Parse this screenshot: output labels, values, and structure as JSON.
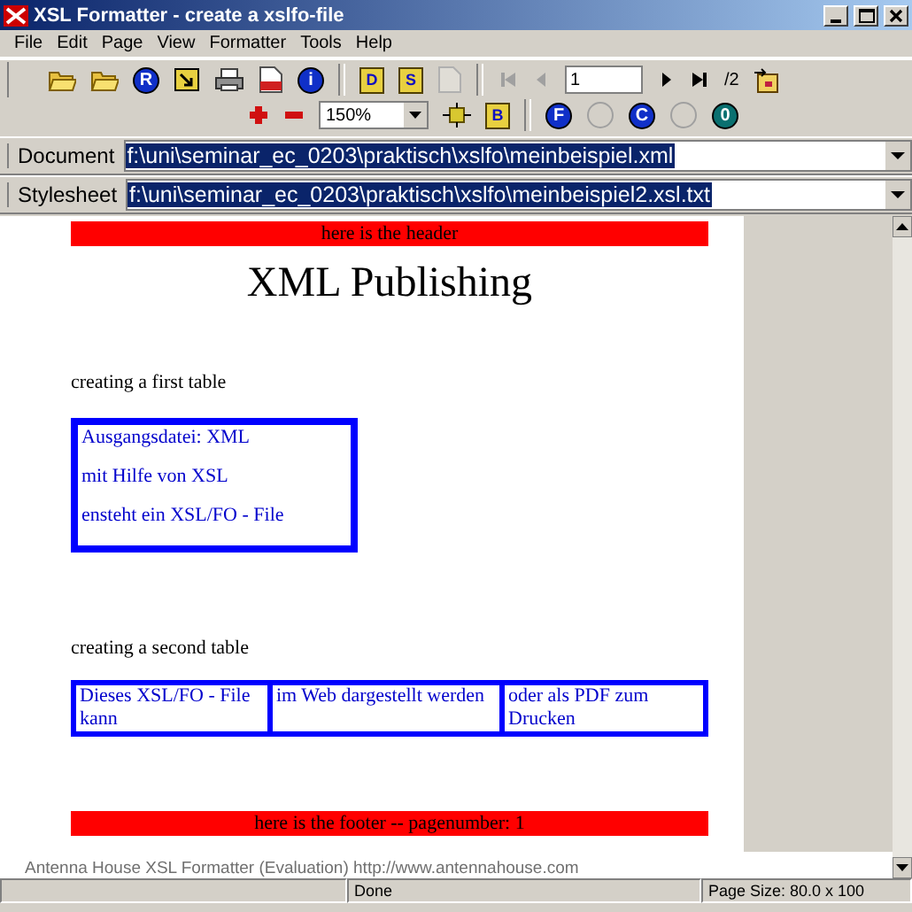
{
  "window": {
    "title": "XSL Formatter - create a xslfo-file"
  },
  "menu": [
    "File",
    "Edit",
    "Page",
    "View",
    "Formatter",
    "Tools",
    "Help"
  ],
  "toolbar": {
    "row_1": [
      {
        "kind": "folder"
      },
      {
        "kind": "folder"
      },
      {
        "kind": "badge",
        "label": "R",
        "color": "#1030c8"
      },
      {
        "kind": "doc-arrow"
      },
      {
        "kind": "printer"
      },
      {
        "kind": "pdf"
      },
      {
        "kind": "badge",
        "label": "i",
        "color": "#1030c8"
      },
      {
        "kind": "separator"
      },
      {
        "kind": "page",
        "label": "D",
        "disabled": false
      },
      {
        "kind": "page",
        "label": "S",
        "disabled": false
      },
      {
        "kind": "page",
        "disabled": true
      },
      {
        "kind": "separator"
      },
      {
        "kind": "first",
        "disabled": true
      },
      {
        "kind": "prev",
        "disabled": true
      },
      {
        "kind": "field",
        "value": "1"
      },
      {
        "kind": "next",
        "disabled": false
      },
      {
        "kind": "last",
        "disabled": false
      },
      {
        "kind": "text",
        "label": "/2"
      },
      {
        "kind": "export"
      }
    ],
    "row_2": [
      {
        "kind": "plus"
      },
      {
        "kind": "minus"
      },
      {
        "kind": "dropdown",
        "value": "150%"
      },
      {
        "kind": "fit"
      },
      {
        "kind": "page",
        "label": "B",
        "disabled": false
      },
      {
        "kind": "separator"
      },
      {
        "kind": "badge",
        "label": "F",
        "color": "#1030c8"
      },
      {
        "kind": "circle"
      },
      {
        "kind": "badge",
        "label": "C",
        "color": "#1030c8"
      },
      {
        "kind": "circle"
      },
      {
        "kind": "badge",
        "label": "0",
        "color": "#0a7070"
      }
    ]
  },
  "paths": [
    {
      "label": "Document",
      "value": "f:\\uni\\seminar_ec_0203\\praktisch\\xslfo\\meinbeispiel.xml",
      "selected": true
    },
    {
      "label": "Stylesheet",
      "value": "f:\\uni\\seminar_ec_0203\\praktisch\\xslfo\\meinbeispiel2.xsl.txt",
      "selected": true
    }
  ],
  "page": {
    "header": "here is the header",
    "title": "XML Publishing",
    "sections": [
      {
        "heading": "creating a first table",
        "kind": "lines",
        "items": [
          "Ausgangsdatei: XML",
          "mit Hilfe von XSL",
          "ensteht ein XSL/FO - File"
        ]
      },
      {
        "heading": "creating a second table",
        "kind": "cells",
        "items": [
          "Dieses XSL/FO - File kann",
          "im Web dargestellt werden",
          "oder als PDF zum Drucken"
        ]
      }
    ],
    "footer": "here is the footer -- pagenumber: 1"
  },
  "evaluation_note": "Antenna House XSL Formatter (Evaluation)  http://www.antennahouse.com",
  "status_bar": {
    "message": "Done",
    "page_size": "Page Size: 80.0 x 100"
  }
}
